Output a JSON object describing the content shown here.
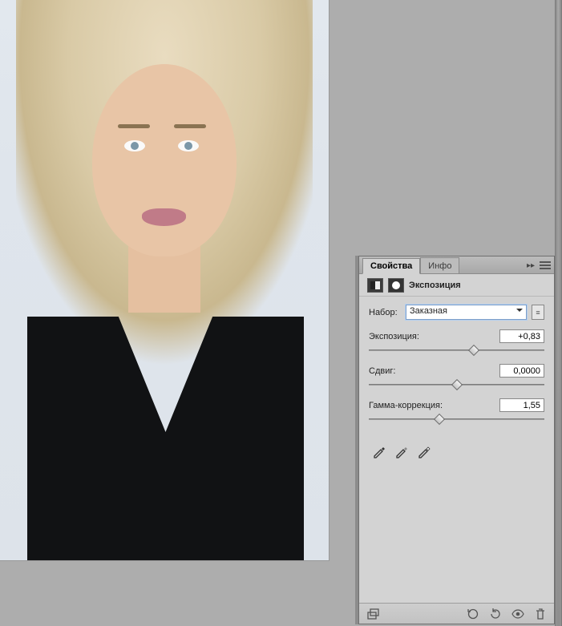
{
  "tabs": {
    "properties": "Свойства",
    "info": "Инфо"
  },
  "header": {
    "title": "Экспозиция"
  },
  "preset": {
    "label": "Набор:",
    "value": "Заказная"
  },
  "controls": {
    "exposure": {
      "label": "Экспозиция:",
      "value": "+0,83",
      "pos": 60
    },
    "offset": {
      "label": "Сдвиг:",
      "value": "0,0000",
      "pos": 50
    },
    "gamma": {
      "label": "Гамма-коррекция:",
      "value": "1,55",
      "pos": 40
    }
  }
}
